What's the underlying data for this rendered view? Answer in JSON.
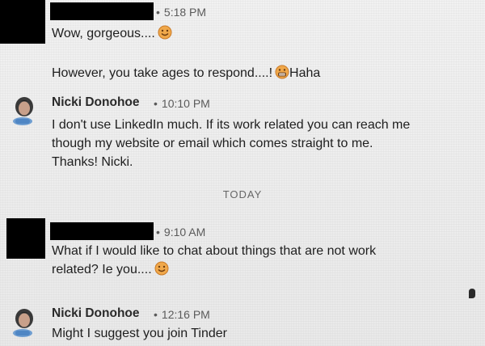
{
  "messages": [
    {
      "sender_hidden": true,
      "time": "5:18 PM",
      "lines": [
        "Wow, gorgeous....",
        "",
        "However, you take ages to respond....!"
      ],
      "trailing_text": "Haha",
      "emoji_1": "smile-emoji",
      "emoji_2": "grimace-emoji"
    },
    {
      "sender": "Nicki Donohoe",
      "time": "10:10 PM",
      "lines": [
        "I don't use LinkedIn much. If its work related you can reach me",
        "though my website or email which comes straight to me.",
        "Thanks! Nicki."
      ]
    },
    {
      "sender_hidden": true,
      "time": "9:10 AM",
      "lines": [
        "What if I would like to chat about things that are not work",
        "related? Ie you...."
      ],
      "emoji_1": "smile-emoji"
    },
    {
      "sender": "Nicki Donohoe",
      "time": "12:16 PM",
      "lines": [
        "Might I suggest you join Tinder"
      ]
    }
  ],
  "divider": "TODAY",
  "colors": {
    "background": "#ececec",
    "text": "#1e1e1e",
    "meta": "#5a5a5a",
    "redaction": "#000000",
    "emoji": "#f0a84a"
  }
}
